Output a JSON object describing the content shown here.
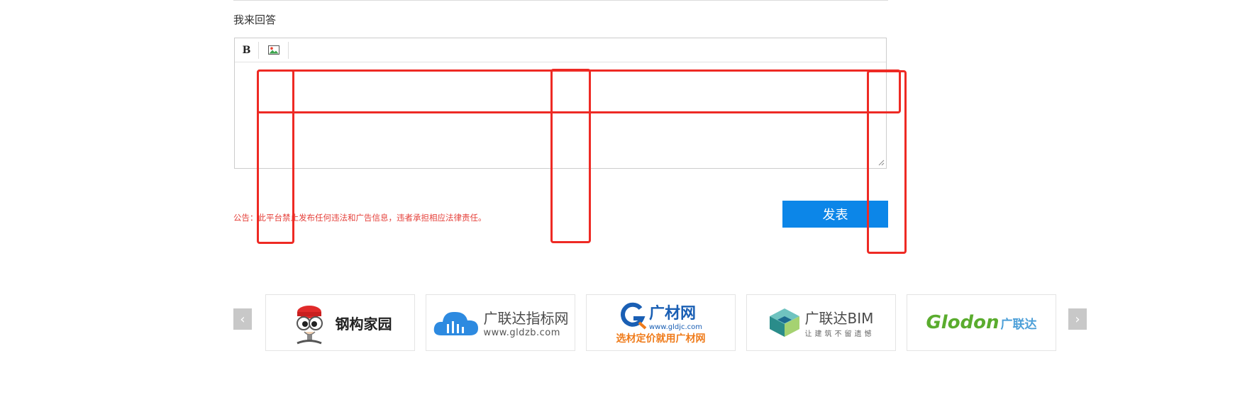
{
  "reply_section": {
    "title": "我来回答"
  },
  "editor": {
    "toolbar": {
      "bold_label": "B"
    },
    "body_value": "",
    "body_placeholder": ""
  },
  "notice": {
    "text": "公告：此平台禁止发布任何违法和广告信息，违者承担相应法律责任。"
  },
  "submit": {
    "label": "发表"
  },
  "partners": {
    "prev_arrow": "‹",
    "next_arrow": "›",
    "items": [
      {
        "name": "钢构家园"
      },
      {
        "name": "广联达指标网",
        "url": "www.gldzb.com"
      },
      {
        "name": "广材网",
        "url": "www.gldjc.com",
        "slogan": "选材定价就用广材网"
      },
      {
        "name": "广联达BIM",
        "slogan": "让建筑不留遗憾"
      },
      {
        "brand": "Glodon",
        "name": "广联达"
      }
    ]
  },
  "colors": {
    "accent_blue": "#0c86e8",
    "notice_red": "#e5403a",
    "annotation_red": "#ee2a24"
  }
}
